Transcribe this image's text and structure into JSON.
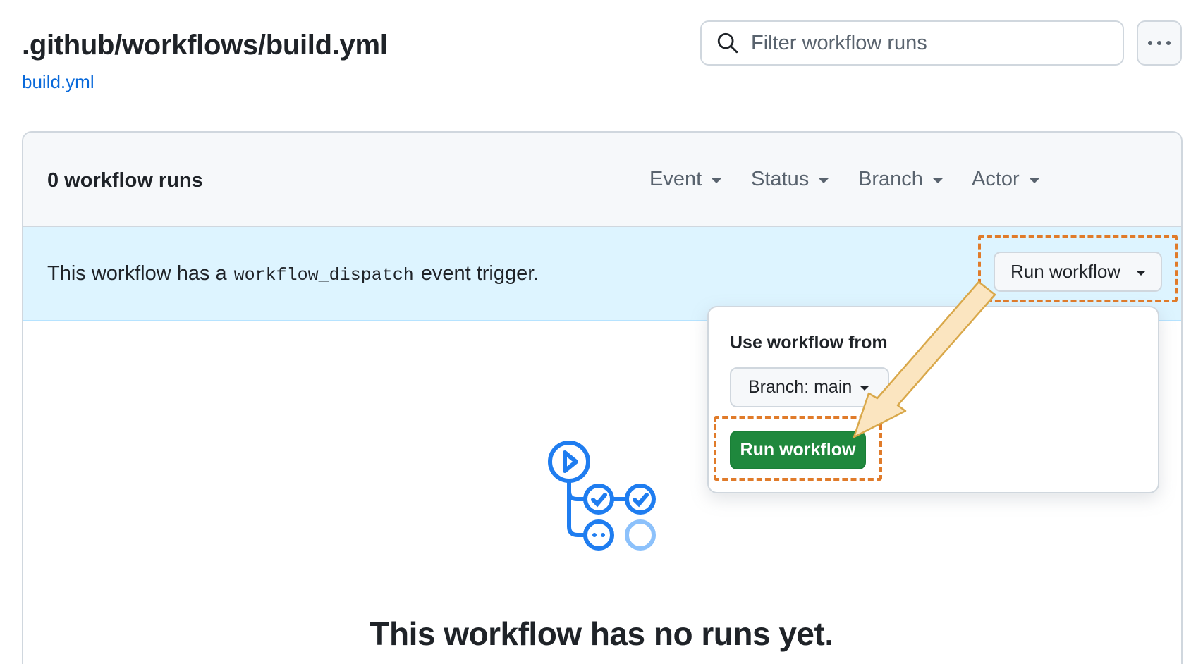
{
  "header": {
    "title": ".github/workflows/build.yml",
    "file_link": "build.yml"
  },
  "search": {
    "placeholder": "Filter workflow runs",
    "icon": "search-icon"
  },
  "more_menu": {
    "icon": "kebab-horizontal-icon"
  },
  "runs_panel": {
    "count_label": "0 workflow runs",
    "filters": [
      {
        "label": "Event"
      },
      {
        "label": "Status"
      },
      {
        "label": "Branch"
      },
      {
        "label": "Actor"
      }
    ]
  },
  "banner": {
    "text_before": "This workflow has a",
    "code": "workflow_dispatch",
    "text_after": "event trigger.",
    "run_button_label": "Run workflow"
  },
  "dropdown": {
    "title": "Use workflow from",
    "branch_button_label": "Branch: main",
    "run_button_label": "Run workflow"
  },
  "empty_state": {
    "illustration_icon": "workflow-runs-icon",
    "title": "This workflow has no runs yet."
  },
  "colors": {
    "link": "#0969da",
    "banner_bg": "#ddf4ff",
    "primary_button": "#1f883d",
    "highlight_outline": "#e07b2a",
    "arrow_fill": "#fbe5c0",
    "icon_blue": "#1f7df0"
  }
}
